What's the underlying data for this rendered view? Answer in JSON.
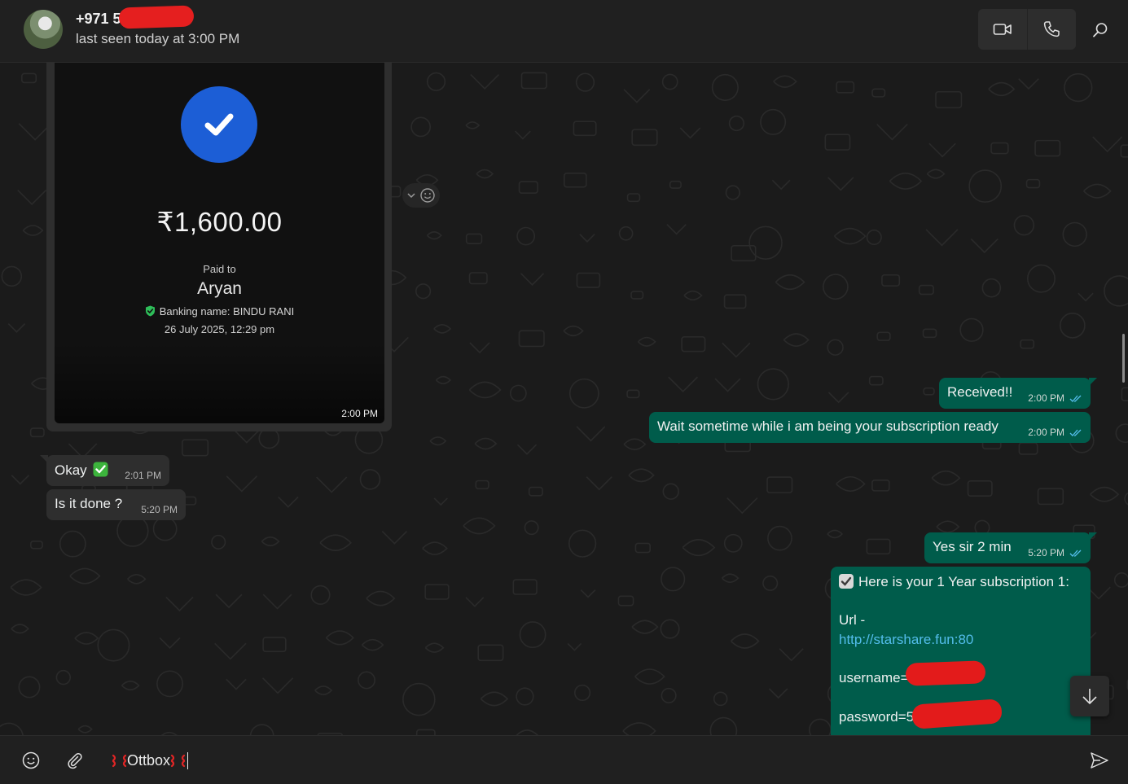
{
  "header": {
    "contact_name": "+971 5(",
    "last_seen": "last seen today at 3:00 PM",
    "icons": [
      "video-call-icon",
      "voice-call-icon",
      "search-icon"
    ]
  },
  "payment_card": {
    "amount": "₹1,600.00",
    "paid_to_label": "Paid to",
    "payee": "Aryan",
    "banking_name": "Banking name: BINDU RANI",
    "date": "26 July 2025, 12:29 pm",
    "time": "2:00 PM"
  },
  "messages": [
    {
      "direction": "out",
      "text": "Received!!",
      "time": "2:00 PM",
      "status": "read"
    },
    {
      "direction": "out",
      "text": "Wait sometime while i am being your subscription ready",
      "time": "2:00 PM",
      "status": "read"
    },
    {
      "direction": "in",
      "text": "Okay",
      "emoji": "check-mark-button",
      "time": "2:01 PM"
    },
    {
      "direction": "in",
      "text": "Is it done ?",
      "time": "5:20 PM"
    },
    {
      "direction": "out",
      "text": "Yes sir 2 min",
      "time": "5:20 PM",
      "status": "read"
    }
  ],
  "subscription_msg": {
    "heading": "Here is your 1 Year subscription 1:",
    "url_label": "Url -",
    "url": "http://starshare.fun:80",
    "username": "username=5(",
    "password": "password=50"
  },
  "composer": {
    "text": "Ottbox"
  },
  "colors": {
    "outgoing_bubble": "#005c4b",
    "incoming_bubble": "#2e2e2e",
    "link": "#53bdeb",
    "read_ticks": "#53bdeb",
    "redaction": "#e51f1f"
  }
}
